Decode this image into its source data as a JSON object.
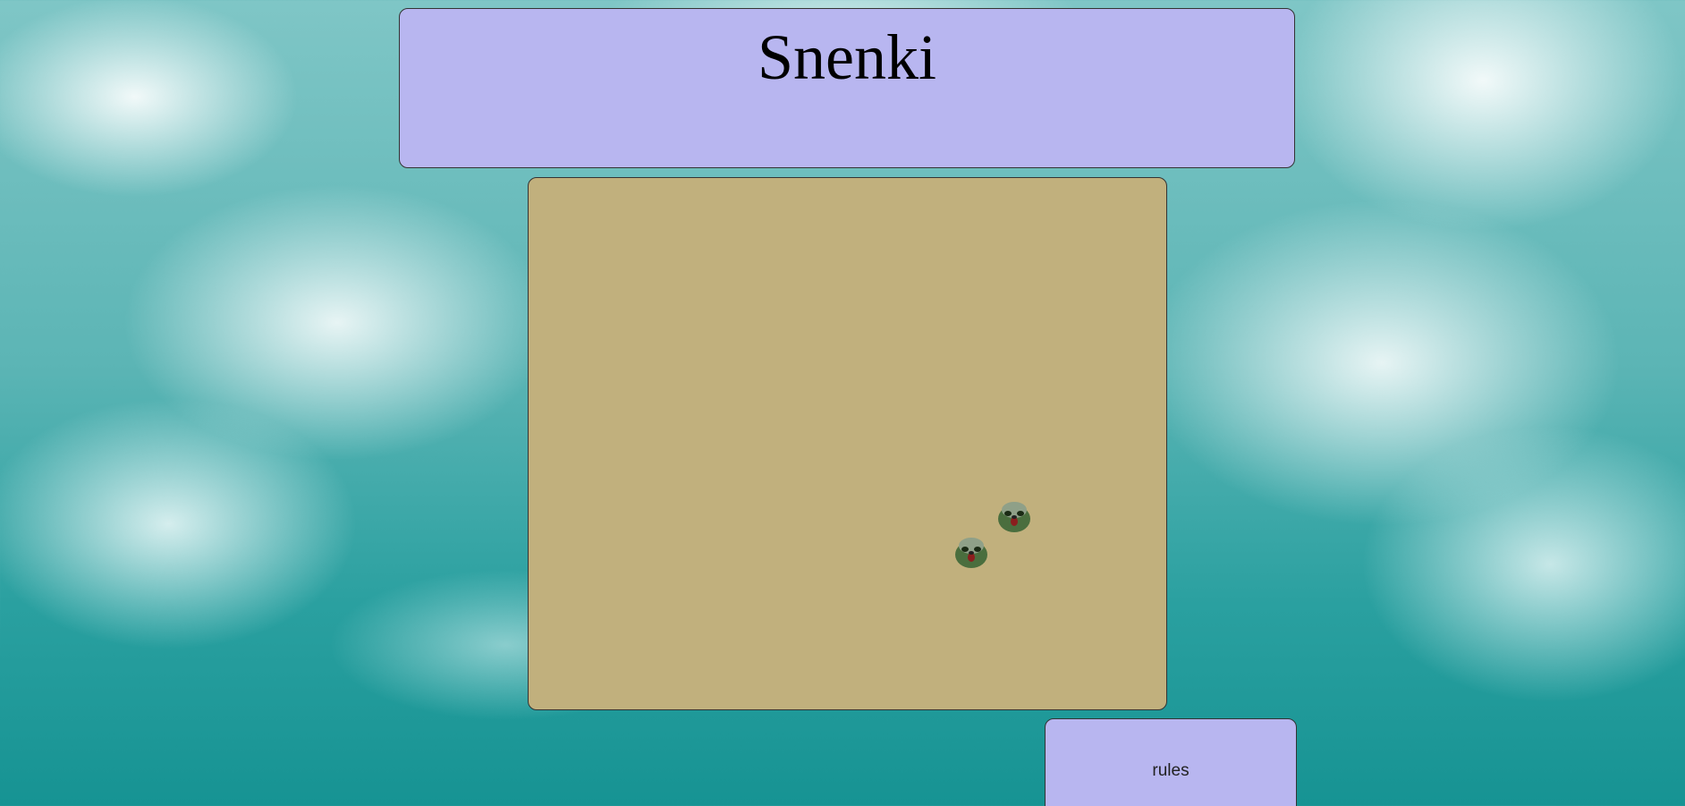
{
  "header": {
    "title": "Snenki"
  },
  "board": {
    "snake_segments": [
      {
        "icon": "seal-head-icon"
      },
      {
        "icon": "seal-head-icon"
      }
    ]
  },
  "rules_button": {
    "label": "rules"
  },
  "colors": {
    "panel": "#b8b6f0",
    "board": "#c1b07d",
    "water": "#2aa0a0"
  }
}
